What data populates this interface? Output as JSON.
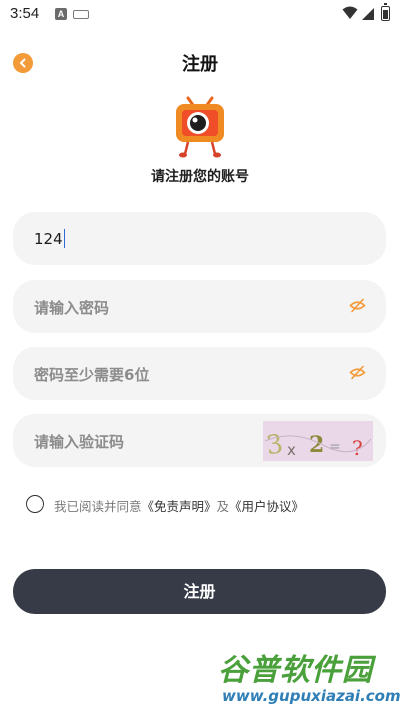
{
  "status_bar": {
    "time": "3:54",
    "notification_glyph": "A",
    "icons": [
      "notification-a-icon",
      "keyboard-icon",
      "wifi-icon",
      "signal-icon",
      "battery-icon"
    ]
  },
  "header": {
    "title": "注册",
    "back_icon": "chevron-left-icon"
  },
  "logo": {
    "icon": "tv-mascot-logo"
  },
  "subtitle": "请注册您的账号",
  "form": {
    "account": {
      "value": "124"
    },
    "password": {
      "placeholder": "请输入密码",
      "toggle_icon": "eye-hidden-icon"
    },
    "confirm_password": {
      "placeholder": "密码至少需要6位",
      "toggle_icon": "eye-hidden-icon"
    },
    "captcha": {
      "placeholder": "请输入验证码",
      "image_text": "3x2=?"
    }
  },
  "agreement": {
    "prefix": "我已阅读并同意",
    "disclaimer_link": "《免责声明》",
    "conjunction": "及",
    "user_agreement_link": "《用户协议》",
    "checked": false
  },
  "submit": {
    "label": "注册"
  },
  "watermark": {
    "brand": "谷普软件园",
    "url": "www.gupuxiazai.com"
  },
  "colors": {
    "accent": "#f39a39",
    "button": "#363b47",
    "field_bg": "#f4f4f4",
    "watermark_green": "#4aa03a",
    "watermark_blue": "#2f7fb6"
  }
}
